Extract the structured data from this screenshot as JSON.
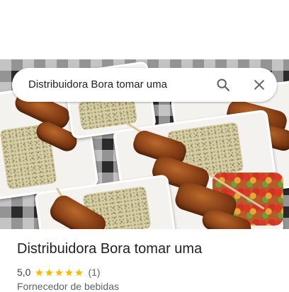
{
  "search": {
    "query": "Distribuidora Bora tomar uma"
  },
  "place": {
    "name": "Distribuidora Bora tomar uma",
    "rating": "5,0",
    "stars": 5,
    "review_count": "(1)",
    "category": "Fornecedor de bebidas"
  },
  "icons": {
    "search": "search-icon",
    "close": "close-icon",
    "star": "star-icon"
  },
  "colors": {
    "star": "#fbbc04",
    "icon": "#5f6368",
    "title": "#202124"
  }
}
